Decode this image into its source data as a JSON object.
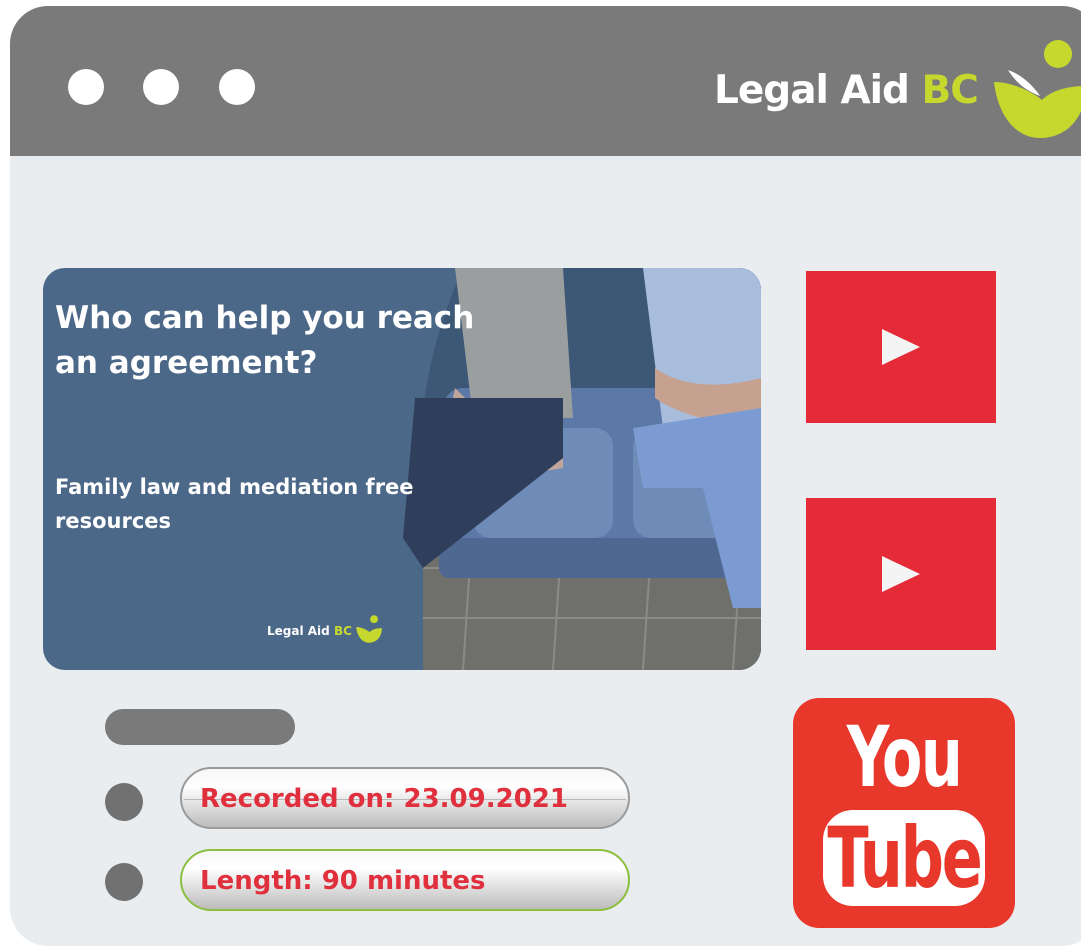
{
  "window": {
    "brand_text": "Legal Aid",
    "brand_accent": "BC",
    "traffic_dots": [
      "dot-1",
      "dot-2",
      "dot-3"
    ]
  },
  "video": {
    "title": "Who can help you reach an agreement?",
    "subtitle": "Family  law  and mediation free resources",
    "brand_text": "Legal Aid",
    "brand_accent": "BC"
  },
  "sidebar": {
    "play_buttons": [
      "play-icon",
      "play-icon"
    ],
    "youtube": {
      "top": "You",
      "bottom": "Tube"
    }
  },
  "details": {
    "recorded": "Recorded on: 23.09.2021",
    "length": "Length:  90 minutes"
  },
  "colors": {
    "titlebar": "#7a7a7a",
    "background": "#e9edf0",
    "brand_green": "#c6d82e",
    "video_panel": "#4c6888",
    "play_red": "#e52b38",
    "youtube_red": "#e8382c",
    "detail_text_red": "#e0303e"
  }
}
